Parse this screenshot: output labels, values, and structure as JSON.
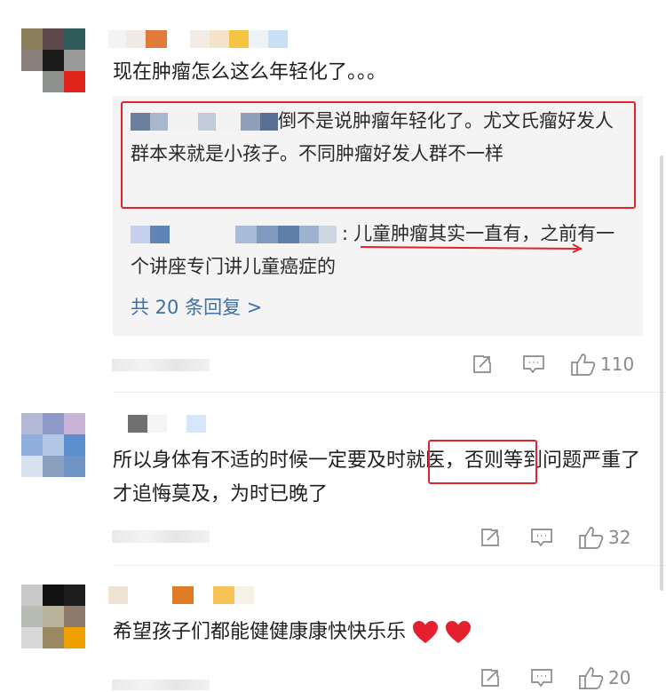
{
  "comments": [
    {
      "text": "现在肿瘤怎么这么年轻化了。。。",
      "replies": [
        {
          "text": "倒不是说肿瘤年轻化了。尤文氏瘤好发人群本来就是小孩子。不同肿瘤好发人群不一样"
        },
        {
          "separator": ":",
          "text_underlined": "儿童肿瘤其实一直有，",
          "text_rest": "之前有一个讲座专门讲儿童癌症的"
        }
      ],
      "more_replies": "共 20 条回复 >",
      "likes": "110"
    },
    {
      "text_before": "所以身体有不适的时候一定要",
      "text_highlight": "及时就医",
      "text_after": "，否则等到问题严重了才追悔莫及，为时已晚了",
      "likes": "32"
    },
    {
      "text": "希望孩子们都能健健康康快快乐乐",
      "likes": "20"
    }
  ],
  "icons": {
    "share": "share-icon",
    "comment": "comment-icon",
    "like": "thumbs-up-icon",
    "heart": "heart-emoji-icon"
  },
  "colors": {
    "accent_red": "#e0242b",
    "link_blue": "#3e6fa8",
    "heart": "#e5202e"
  }
}
